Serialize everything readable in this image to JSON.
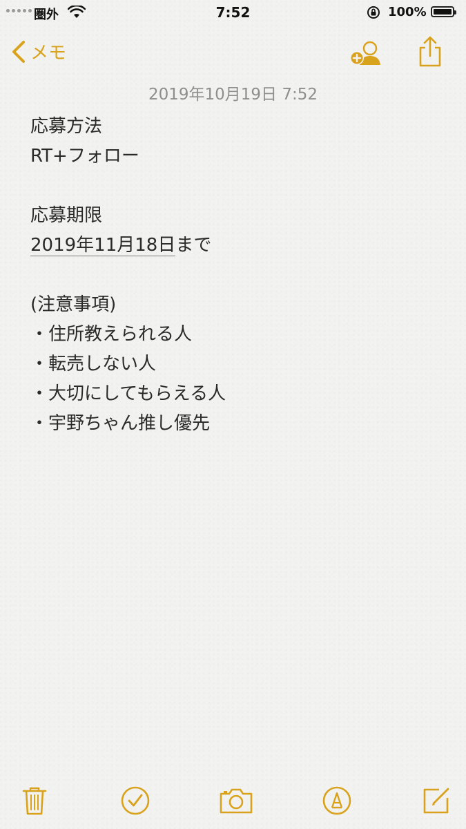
{
  "status_bar": {
    "carrier": "圏外",
    "time": "7:52",
    "battery_percent": "100%",
    "battery_level": 1.0
  },
  "nav": {
    "back_label": "メモ",
    "accent_color": "#d9a21c"
  },
  "note": {
    "date": "2019年10月19日 7:52",
    "lines": [
      "応募方法",
      "RT+フォロー",
      "",
      "応募期限",
      "",
      "",
      "(注意事項)",
      "・住所教えられる人",
      "・転売しない人",
      "・大切にしてもらえる人",
      "・宇野ちゃん推し優先"
    ],
    "deadline_date": "2019年11月18日",
    "deadline_suffix": "まで"
  },
  "toolbar": {
    "icons": [
      "trash-icon",
      "checklist-icon",
      "camera-icon",
      "markup-icon",
      "compose-icon"
    ]
  }
}
